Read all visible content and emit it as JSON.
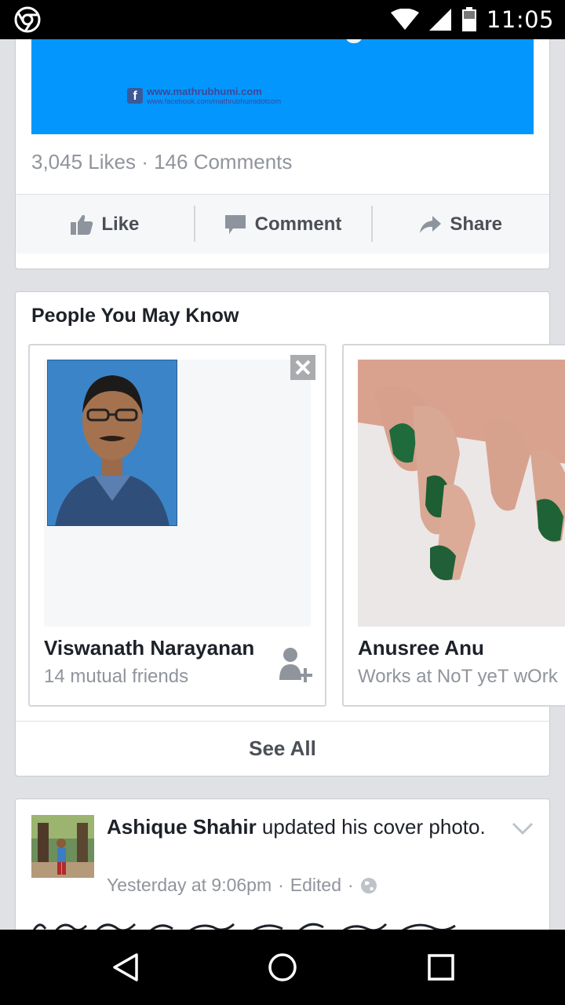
{
  "status_bar": {
    "time": "11:05",
    "icons": [
      "chrome-icon",
      "wifi-icon",
      "signal-icon",
      "battery-icon"
    ]
  },
  "post1": {
    "banner": {
      "website": "www.mathrubhumi.com",
      "facebook_url": "www.facebook.com/mathrubhumidotcom",
      "color": "#0396fc"
    },
    "counts": "3,045 Likes · 146 Comments",
    "actions": {
      "like": "Like",
      "comment": "Comment",
      "share": "Share"
    }
  },
  "pymk": {
    "title": "People You May Know",
    "people": [
      {
        "name": "Viswanath Narayanan",
        "subtitle": "14 mutual friends"
      },
      {
        "name": "Anusree Anu",
        "subtitle": "Works at NoT yeT wOrk"
      }
    ],
    "see_all": "See All"
  },
  "post3": {
    "author": "Ashique Shahir",
    "action": " updated his cover photo.",
    "time": "Yesterday at 9:06pm",
    "edited": "Edited",
    "privacy_icon": "globe-icon"
  },
  "nav": {
    "icons": [
      "back-icon",
      "home-icon",
      "recents-icon"
    ]
  }
}
